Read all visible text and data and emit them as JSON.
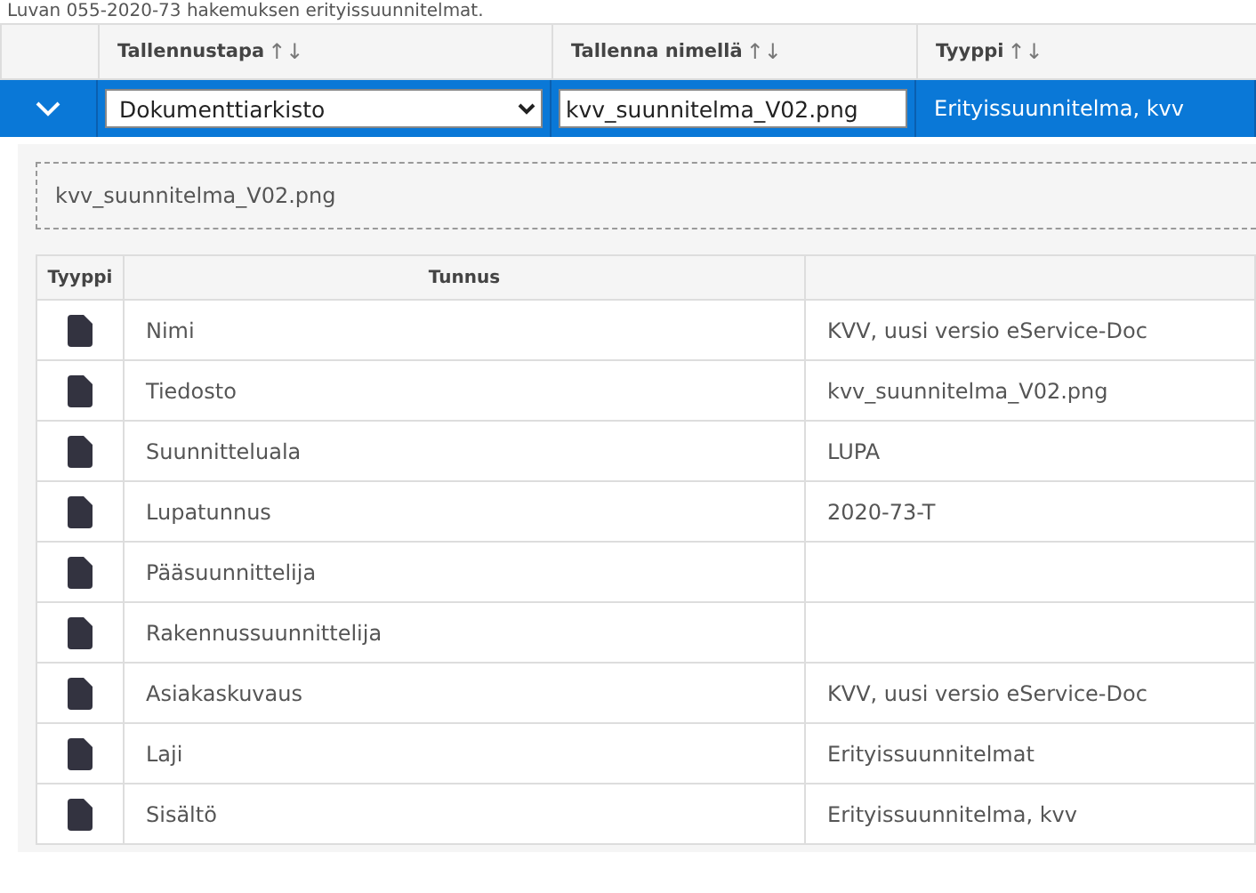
{
  "caption": "Luvan 055-2020-73 hakemuksen erityissuunnitelmat.",
  "table": {
    "columns": [
      {
        "label": "Tallennustapa",
        "sort_icon": "↑↓"
      },
      {
        "label": "Tallenna nimellä",
        "sort_icon": "↑↓"
      },
      {
        "label": "Tyyppi",
        "sort_icon": "↑↓"
      }
    ],
    "row": {
      "expanded": true,
      "selected": true,
      "save_method": "Dokumenttiarkisto",
      "save_name": "kvv_suunnitelma_V02.png",
      "type": "Erityissuunnitelma, kvv"
    }
  },
  "detail": {
    "file_drop": "kvv_suunnitelma_V02.png",
    "columns": [
      "Tyyppi",
      "Tunnus"
    ],
    "rows": [
      {
        "label": "Nimi",
        "value": "KVV, uusi versio eService-Doc"
      },
      {
        "label": "Tiedosto",
        "value": "kvv_suunnitelma_V02.png"
      },
      {
        "label": "Suunnitteluala",
        "value": "LUPA"
      },
      {
        "label": "Lupatunnus",
        "value": "2020-73-T"
      },
      {
        "label": "Pääsuunnittelija",
        "value": ""
      },
      {
        "label": "Rakennussuunnittelija",
        "value": ""
      },
      {
        "label": "Asiakaskuvaus",
        "value": "KVV, uusi versio eService-Doc"
      },
      {
        "label": "Laji",
        "value": "Erityissuunnitelmat"
      },
      {
        "label": "Sisältö",
        "value": "Erityissuunnitelma, kvv"
      }
    ]
  }
}
